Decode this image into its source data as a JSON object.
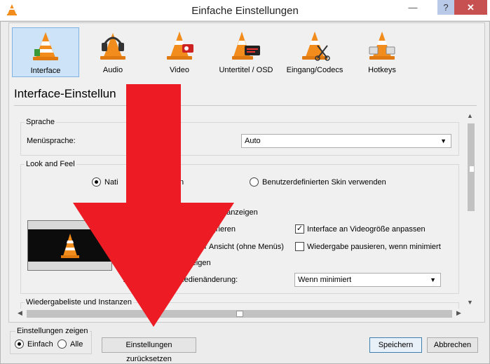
{
  "window": {
    "title": "Einfache Einstellungen"
  },
  "categories": [
    {
      "label": "Interface",
      "selected": true,
      "icon": "interface-cone-icon"
    },
    {
      "label": "Audio",
      "selected": false,
      "icon": "audio-headphones-cone-icon"
    },
    {
      "label": "Video",
      "selected": false,
      "icon": "video-cone-icon"
    },
    {
      "label": "Untertitel / OSD",
      "selected": false,
      "icon": "subtitles-cone-icon"
    },
    {
      "label": "Eingang/Codecs",
      "selected": false,
      "icon": "input-codecs-cone-icon"
    },
    {
      "label": "Hotkeys",
      "selected": false,
      "icon": "hotkeys-cone-icon"
    }
  ],
  "section_title": "Interface-Einstellun",
  "language_group": {
    "label": "Sprache",
    "menu_language_label": "Menüsprache:",
    "menu_language_value": "Auto"
  },
  "look_feel_group": {
    "label": "Look and Feel",
    "native_label": "Nati",
    "native_label_tail": "n",
    "custom_skin_label": "Benutzerdefinierten Skin verwenden",
    "fullscreen_mode_label": "modus anzeigen",
    "integrate_label": "integrieren",
    "resize_label": "Interface an Videogröße anpassen",
    "minimal_label": "naler Ansicht (ohne Menüs)",
    "pause_label": "Wiedergabe pausieren, wenn minimiert",
    "show_label": "anzeigen",
    "media_change_label_a": "Ze",
    "media_change_label_b": "i Medienänderung:",
    "media_change_value": "Wenn minimiert"
  },
  "playlist_group": {
    "label": "Wiedergabeliste und Instanzen"
  },
  "show_settings": {
    "label": "Einstellungen zeigen",
    "simple": "Einfach",
    "all": "Alle",
    "selected": "simple"
  },
  "buttons": {
    "reset": "Einstellungen zurücksetzen",
    "save": "Speichern",
    "cancel": "Abbrechen"
  },
  "colors": {
    "accent": "#cde3f8",
    "arrow": "#ed1c24",
    "cone": "#f28c1c"
  }
}
